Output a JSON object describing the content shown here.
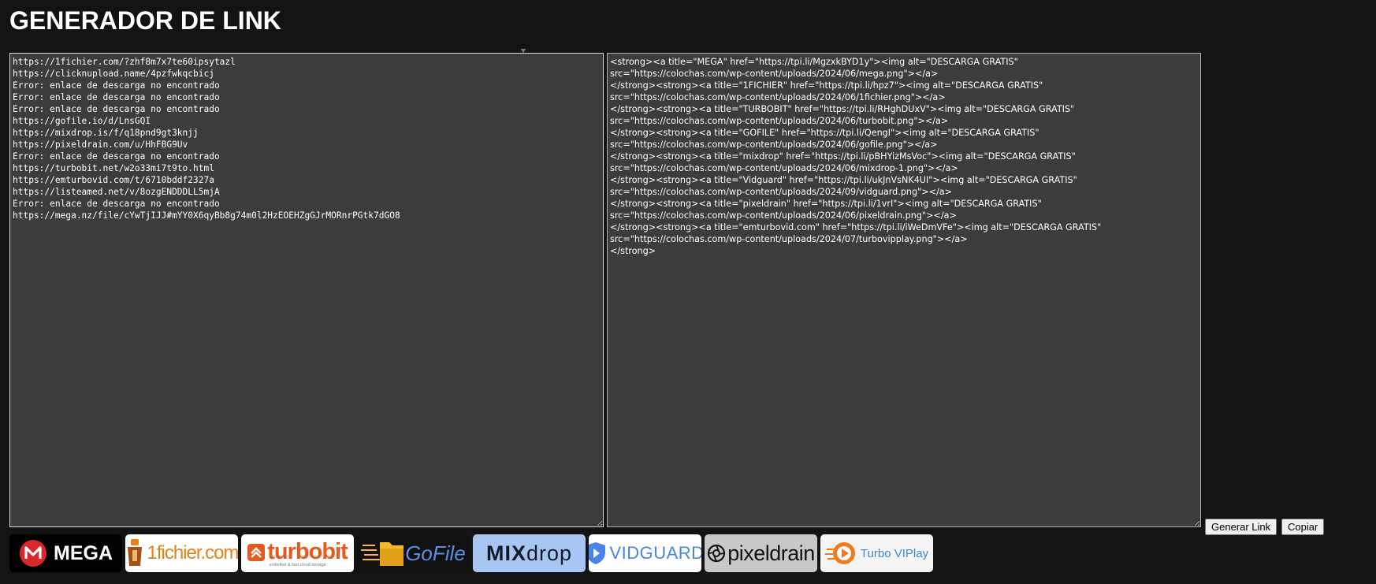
{
  "page": {
    "title": "GENERADOR DE LINK"
  },
  "input": {
    "value": "https://1fichier.com/?zhf8m7x7te60ipsytazl\nhttps://clicknupload.name/4pzfwkqcbicj\nError: enlace de descarga no encontrado\nError: enlace de descarga no encontrado\nError: enlace de descarga no encontrado\nhttps://gofile.io/d/LnsGQI\nhttps://mixdrop.is/f/q18pnd9gt3knjj\nhttps://pixeldrain.com/u/HhFBG9Uv\nError: enlace de descarga no encontrado\nhttps://turbobit.net/w2o33mi7t9to.html\nhttps://emturbovid.com/t/6710bddf2327a\nhttps://listeamed.net/v/8ozgENDDDLL5mjA\nError: enlace de descarga no encontrado\nhttps://mega.nz/file/cYwTjIJJ#mYY0X6qyBb8g74m0l2HzEOEHZgGJrMORnrPGtk7dGO8"
  },
  "output": {
    "value": "<strong><a title=\"MEGA\" href=\"https://tpi.li/MgzxkBYD1y\"><img alt=\"DESCARGA GRATIS\"\nsrc=\"https://colochas.com/wp-content/uploads/2024/06/mega.png\"></a>\n</strong><strong><a title=\"1FICHIER\" href=\"https://tpi.li/hpz7\"><img alt=\"DESCARGA GRATIS\"\nsrc=\"https://colochas.com/wp-content/uploads/2024/06/1fichier.png\"></a>\n</strong><strong><a title=\"TURBOBIT\" href=\"https://tpi.li/RHghDUxV\"><img alt=\"DESCARGA GRATIS\"\nsrc=\"https://colochas.com/wp-content/uploads/2024/06/turbobit.png\"></a>\n</strong><strong><a title=\"GOFILE\" href=\"https://tpi.li/QengI\"><img alt=\"DESCARGA GRATIS\"\nsrc=\"https://colochas.com/wp-content/uploads/2024/06/gofile.png\"></a>\n</strong><strong><a title=\"mixdrop\" href=\"https://tpi.li/pBHYizMsVoc\"><img alt=\"DESCARGA GRATIS\"\nsrc=\"https://colochas.com/wp-content/uploads/2024/06/mixdrop-1.png\"></a>\n</strong><strong><a title=\"Vidguard\" href=\"https://tpi.li/ukJnVsNK4UI\"><img alt=\"DESCARGA GRATIS\"\nsrc=\"https://colochas.com/wp-content/uploads/2024/09/vidguard.png\"></a>\n</strong><strong><a title=\"pixeldrain\" href=\"https://tpi.li/1vrI\"><img alt=\"DESCARGA GRATIS\"\nsrc=\"https://colochas.com/wp-content/uploads/2024/06/pixeldrain.png\"></a>\n</strong><strong><a title=\"emturbovid.com\" href=\"https://tpi.li/iWeDmVFe\"><img alt=\"DESCARGA GRATIS\"\nsrc=\"https://colochas.com/wp-content/uploads/2024/07/turbovipplay.png\"></a>\n</strong>"
  },
  "buttons": {
    "generate": "Generar Link",
    "copy": "Copiar"
  },
  "logos": {
    "mega": {
      "text": "MEGA",
      "icon": "mega-icon",
      "accent": "#d9272e"
    },
    "fichier": {
      "text": "1fichier.com",
      "icon": "key-icon",
      "accent": "#e8801a"
    },
    "turbobit": {
      "text": "turbobit",
      "tagline": "unlimited & fast cloud storage",
      "icon": "chevron-up-icon",
      "accent": "#e65a1e"
    },
    "gofile": {
      "text": "GoFile",
      "icon": "folder-icon",
      "accent": "#f5b82e"
    },
    "mixdrop": {
      "text_a": "MIX",
      "text_b": "drop",
      "accent": "#a8c6f2"
    },
    "vidguard": {
      "text": "VIDGUARD",
      "icon": "shield-play-icon",
      "accent": "#4a84e8"
    },
    "pixeldrain": {
      "text": "pixeldrain",
      "icon": "aperture-icon",
      "accent": "#111111"
    },
    "turboviplay": {
      "text": "Turbo VIPlay",
      "icon": "play-circle-icon",
      "accent": "#f07a1e"
    }
  }
}
